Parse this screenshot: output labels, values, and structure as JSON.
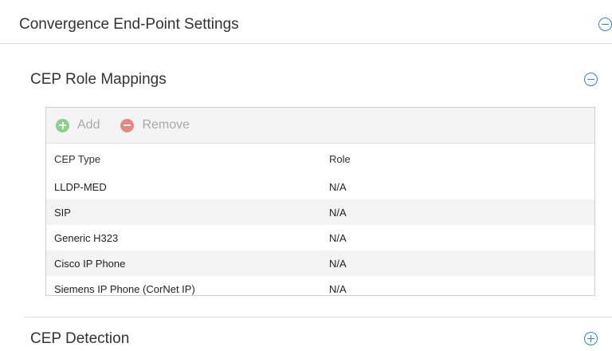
{
  "panel": {
    "title": "Convergence End-Point Settings",
    "toggle_state": "collapse"
  },
  "role_mappings": {
    "title": "CEP Role Mappings",
    "toggle_state": "collapse",
    "toolbar": {
      "add_label": "Add",
      "remove_label": "Remove",
      "add_icon": "add-circle-icon",
      "remove_icon": "remove-circle-icon",
      "add_color": "#6cc26c",
      "remove_color": "#e0665a"
    },
    "table": {
      "headers": [
        "CEP Type",
        "Role"
      ],
      "rows": [
        {
          "cep_type": "LLDP-MED",
          "role": "N/A"
        },
        {
          "cep_type": "SIP",
          "role": "N/A"
        },
        {
          "cep_type": "Generic H323",
          "role": "N/A"
        },
        {
          "cep_type": "Cisco IP Phone",
          "role": "N/A"
        },
        {
          "cep_type": "Siemens IP Phone (CorNet IP)",
          "role": "N/A"
        }
      ]
    }
  },
  "detection": {
    "title": "CEP Detection",
    "toggle_state": "expand"
  },
  "colors": {
    "accent": "#2f86c8",
    "row_alt": "#f3f3f3",
    "toolbar_bg": "#f4f4f4"
  }
}
